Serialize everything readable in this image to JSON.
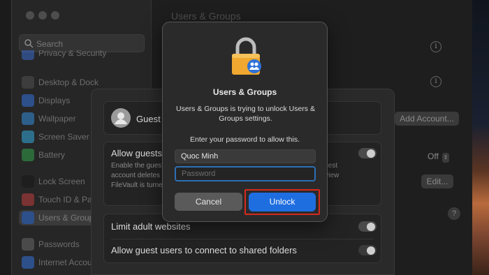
{
  "window": {
    "title": "Users & Groups"
  },
  "sidebar": {
    "search_placeholder": "Search",
    "items": [
      {
        "label": "Privacy & Security",
        "icon": "hand-icon",
        "color": "#3a6fd8"
      },
      {
        "label": "Desktop & Dock",
        "icon": "dock-icon",
        "color": "#444"
      },
      {
        "label": "Displays",
        "icon": "display-icon",
        "color": "#3a6fd8"
      },
      {
        "label": "Wallpaper",
        "icon": "wallpaper-icon",
        "color": "#3a8fd8"
      },
      {
        "label": "Screen Saver",
        "icon": "screensaver-icon",
        "color": "#3aa8d8"
      },
      {
        "label": "Battery",
        "icon": "battery-icon",
        "color": "#3aa850"
      },
      {
        "label": "Lock Screen",
        "icon": "lock-icon",
        "color": "#222"
      },
      {
        "label": "Touch ID & Password",
        "icon": "fingerprint-icon",
        "color": "#d84a4a"
      },
      {
        "label": "Users & Groups",
        "icon": "users-icon",
        "color": "#3a6fd8"
      },
      {
        "label": "Passwords",
        "icon": "key-icon",
        "color": "#777"
      },
      {
        "label": "Internet Accounts",
        "icon": "at-icon",
        "color": "#3a6fd8"
      }
    ]
  },
  "main": {
    "add_account": "Add Account...",
    "off_label": "Off",
    "edit_label": "Edit...",
    "help": "?"
  },
  "sheet": {
    "guest_label": "Guest User",
    "allow_guests": "Allow guests to log in to this computer",
    "allow_desc": "Enable the guest user account on this computer. Logging out of the guest account deletes all files without a password. Users will not be able to view FileVault is turned on.",
    "limit_adult": "Limit adult websites",
    "allow_shared": "Allow guest users to connect to shared folders"
  },
  "dialog": {
    "title": "Users & Groups",
    "message": "Users & Groups is trying to unlock Users & Groups settings.",
    "prompt": "Enter your password to allow this.",
    "username": "Quoc Minh",
    "password_placeholder": "Password",
    "cancel": "Cancel",
    "unlock": "Unlock",
    "highlight_color": "#d62a1e",
    "accent": "#1f6ee0"
  }
}
